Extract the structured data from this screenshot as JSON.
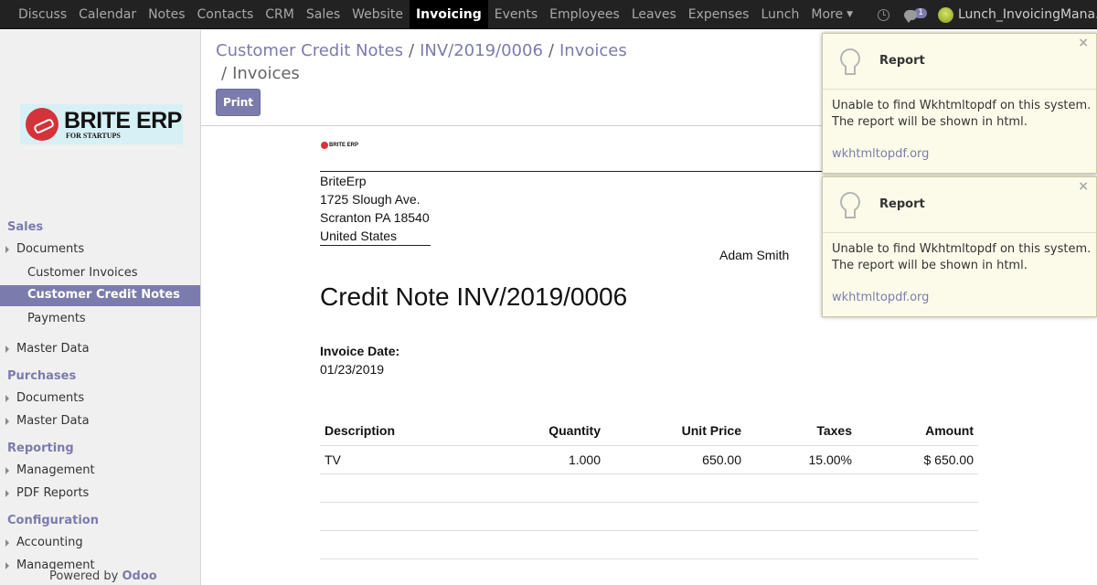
{
  "topbar": {
    "menu": [
      "Discuss",
      "Calendar",
      "Notes",
      "Contacts",
      "CRM",
      "Sales",
      "Website",
      "Invoicing",
      "Events",
      "Employees",
      "Leaves",
      "Expenses",
      "Lunch",
      "More"
    ],
    "active_index": 7,
    "chat_count": "1",
    "user_name": "Lunch_InvoicingMana..."
  },
  "sidebar": {
    "logo": {
      "main": "BRITE ERP",
      "sub": "FOR STARTUPS"
    },
    "sections": {
      "sales": "Sales",
      "purchases": "Purchases",
      "reporting": "Reporting",
      "configuration": "Configuration"
    },
    "items": {
      "sales_documents": "Documents",
      "customer_invoices": "Customer Invoices",
      "customer_credit_notes": "Customer Credit Notes",
      "payments": "Payments",
      "sales_master_data": "Master Data",
      "purchases_documents": "Documents",
      "purchases_master_data": "Master Data",
      "management": "Management",
      "pdf_reports": "PDF Reports",
      "accounting": "Accounting",
      "config_management": "Management"
    },
    "powered_by": "Powered by",
    "powered_brand": "Odoo"
  },
  "control": {
    "breadcrumbs": [
      "Customer Credit Notes",
      "INV/2019/0006",
      "Invoices"
    ],
    "current": "Invoices",
    "separator": "/",
    "print_label": "Print"
  },
  "report": {
    "mini_logo": "BRITE ERP",
    "company": [
      "BriteErp",
      "1725 Slough Ave.",
      "Scranton PA 18540",
      "United States"
    ],
    "partner": "Adam Smith",
    "title": "Credit Note INV/2019/0006",
    "date_label": "Invoice Date:",
    "date_value": "01/23/2019",
    "table": {
      "headers": [
        "Description",
        "Quantity",
        "Unit Price",
        "Taxes",
        "Amount"
      ],
      "rows": [
        [
          "TV",
          "1.000",
          "650.00",
          "15.00%",
          "$ 650.00"
        ]
      ]
    }
  },
  "notifications": [
    {
      "title": "Report",
      "message": "Unable to find Wkhtmltopdf on this system. The report will be shown in html.",
      "link": "wkhtmltopdf.org",
      "close": "×"
    },
    {
      "title": "Report",
      "message": "Unable to find Wkhtmltopdf on this system. The report will be shown in html.",
      "link": "wkhtmltopdf.org",
      "close": "×"
    }
  ],
  "colors": {
    "accent": "#7c7bad",
    "topbar": "#222222",
    "notif_bg": "#fcfbea",
    "logo_red": "#d5333a"
  }
}
